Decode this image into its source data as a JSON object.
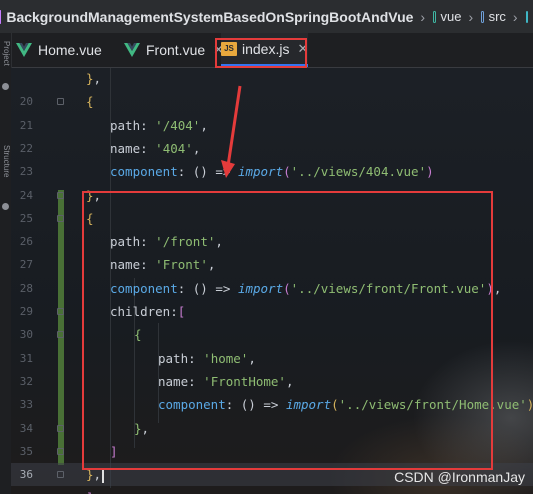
{
  "breadcrumb": {
    "project": "BackgroundManagementSystemBasedOnSpringBootAndVue",
    "items": [
      "vue",
      "src"
    ]
  },
  "tabs": [
    {
      "label": "Home.vue",
      "icon": "vue-icon",
      "active": false
    },
    {
      "label": "Front.vue",
      "icon": "vue-icon",
      "active": false
    },
    {
      "label": "index.js",
      "icon": "js-file-icon",
      "active": true
    }
  ],
  "side_strip": {
    "labels": [
      "Project",
      "Structure"
    ]
  },
  "editor": {
    "current_line": 36,
    "lines": [
      {
        "num": "",
        "tokens": [
          {
            "t": "}",
            "c": "punct"
          },
          {
            "t": ",",
            "c": "plain"
          }
        ]
      },
      {
        "num": "20",
        "tokens": [
          {
            "t": "{",
            "c": "punct"
          }
        ]
      },
      {
        "num": "21",
        "tokens": [
          {
            "t": "path",
            "c": "key"
          },
          {
            "t": ": ",
            "c": "plain"
          },
          {
            "t": "'/404'",
            "c": "str"
          },
          {
            "t": ",",
            "c": "plain"
          }
        ]
      },
      {
        "num": "22",
        "tokens": [
          {
            "t": "name",
            "c": "key"
          },
          {
            "t": ": ",
            "c": "plain"
          },
          {
            "t": "'404'",
            "c": "str"
          },
          {
            "t": ",",
            "c": "plain"
          }
        ]
      },
      {
        "num": "23",
        "tokens": [
          {
            "t": "component",
            "c": "fn"
          },
          {
            "t": ": () => ",
            "c": "plain"
          },
          {
            "t": "import",
            "c": "kw"
          },
          {
            "t": "(",
            "c": "bracket-p"
          },
          {
            "t": "'../views/404.vue'",
            "c": "str"
          },
          {
            "t": ")",
            "c": "bracket-p"
          }
        ]
      },
      {
        "num": "24",
        "tokens": [
          {
            "t": "}",
            "c": "punct"
          },
          {
            "t": ",",
            "c": "plain"
          }
        ]
      },
      {
        "num": "25",
        "tokens": [
          {
            "t": "{",
            "c": "punct"
          }
        ]
      },
      {
        "num": "26",
        "tokens": [
          {
            "t": "path",
            "c": "key"
          },
          {
            "t": ": ",
            "c": "plain"
          },
          {
            "t": "'/front'",
            "c": "str"
          },
          {
            "t": ",",
            "c": "plain"
          }
        ]
      },
      {
        "num": "27",
        "tokens": [
          {
            "t": "name",
            "c": "key"
          },
          {
            "t": ": ",
            "c": "plain"
          },
          {
            "t": "'Front'",
            "c": "str"
          },
          {
            "t": ",",
            "c": "plain"
          }
        ]
      },
      {
        "num": "28",
        "tokens": [
          {
            "t": "component",
            "c": "fn"
          },
          {
            "t": ": () => ",
            "c": "plain"
          },
          {
            "t": "import",
            "c": "kw"
          },
          {
            "t": "(",
            "c": "bracket-p"
          },
          {
            "t": "'../views/front/Front.vue'",
            "c": "str"
          },
          {
            "t": ")",
            "c": "bracket-p"
          },
          {
            "t": ",",
            "c": "plain"
          }
        ]
      },
      {
        "num": "29",
        "tokens": [
          {
            "t": "children",
            "c": "key"
          },
          {
            "t": ":",
            "c": "plain"
          },
          {
            "t": "[",
            "c": "bracket-p"
          }
        ]
      },
      {
        "num": "30",
        "tokens": [
          {
            "t": "{",
            "c": "str"
          }
        ]
      },
      {
        "num": "31",
        "tokens": [
          {
            "t": "path",
            "c": "key"
          },
          {
            "t": ": ",
            "c": "plain"
          },
          {
            "t": "'home'",
            "c": "str"
          },
          {
            "t": ",",
            "c": "plain"
          }
        ]
      },
      {
        "num": "32",
        "tokens": [
          {
            "t": "name",
            "c": "key"
          },
          {
            "t": ": ",
            "c": "plain"
          },
          {
            "t": "'FrontHome'",
            "c": "str"
          },
          {
            "t": ",",
            "c": "plain"
          }
        ]
      },
      {
        "num": "33",
        "tokens": [
          {
            "t": "component",
            "c": "fn"
          },
          {
            "t": ": () => ",
            "c": "plain"
          },
          {
            "t": "import",
            "c": "kw"
          },
          {
            "t": "(",
            "c": "punct"
          },
          {
            "t": "'../views/front/Home.vue'",
            "c": "str"
          },
          {
            "t": ")",
            "c": "punct"
          }
        ]
      },
      {
        "num": "34",
        "tokens": [
          {
            "t": "}",
            "c": "str"
          },
          {
            "t": ",",
            "c": "plain"
          }
        ]
      },
      {
        "num": "35",
        "tokens": [
          {
            "t": "]",
            "c": "bracket-p"
          }
        ]
      },
      {
        "num": "36",
        "tokens": [
          {
            "t": "}",
            "c": "punct"
          },
          {
            "t": ",",
            "c": "plain"
          }
        ]
      },
      {
        "num": "",
        "tokens": [
          {
            "t": "]",
            "c": "bracket-p"
          }
        ]
      }
    ]
  },
  "watermark": "CSDN @IronmanJay",
  "colors": {
    "highlight_border": "#e43b3b",
    "change_bar": "#4f7a39",
    "tab_active_underline": "#3574f0"
  }
}
